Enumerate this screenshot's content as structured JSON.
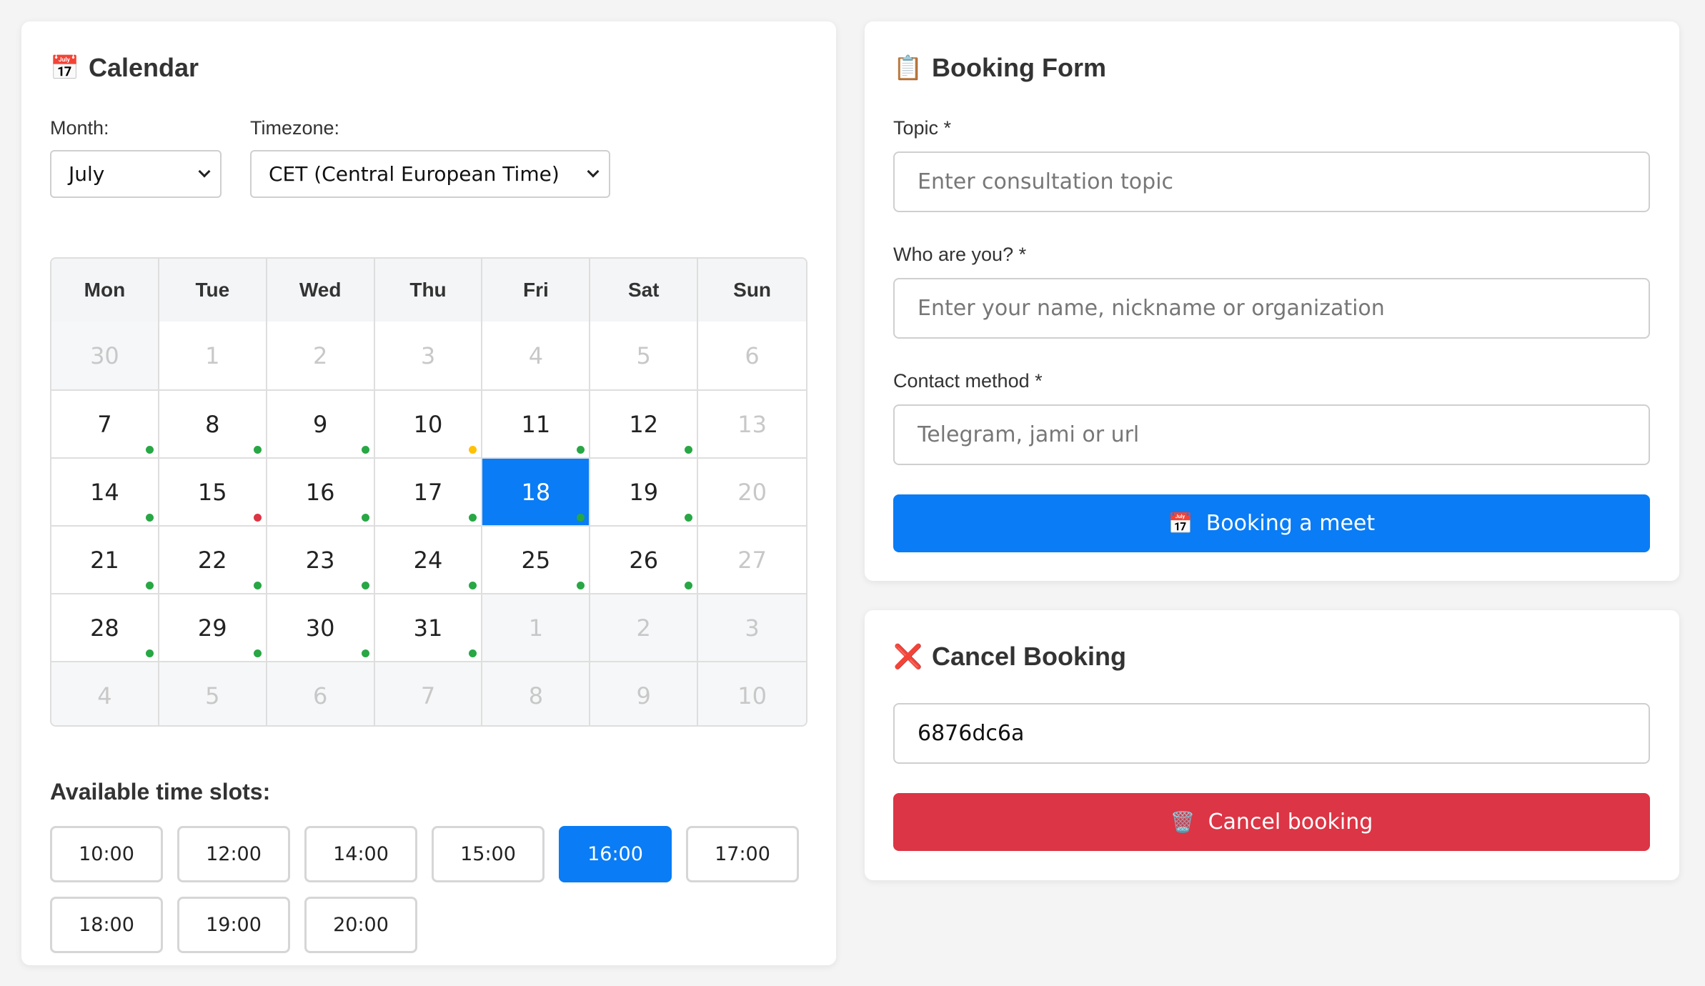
{
  "calendar": {
    "title": "Calendar",
    "icon": "calendar-icon",
    "month_label": "Month:",
    "month_value": "July",
    "timezone_label": "Timezone:",
    "timezone_value": "CET (Central European Time)",
    "weekdays": [
      "Mon",
      "Tue",
      "Wed",
      "Thu",
      "Fri",
      "Sat",
      "Sun"
    ],
    "status_colors": {
      "available": "#28a745",
      "partial": "#ffc107",
      "full": "#dc3545"
    },
    "weeks": [
      [
        {
          "day": "30",
          "state": "muted-other"
        },
        {
          "day": "1",
          "state": "muted"
        },
        {
          "day": "2",
          "state": "muted"
        },
        {
          "day": "3",
          "state": "muted"
        },
        {
          "day": "4",
          "state": "muted"
        },
        {
          "day": "5",
          "state": "muted"
        },
        {
          "day": "6",
          "state": "muted"
        }
      ],
      [
        {
          "day": "7",
          "dot": "available"
        },
        {
          "day": "8",
          "dot": "available"
        },
        {
          "day": "9",
          "dot": "available"
        },
        {
          "day": "10",
          "dot": "partial"
        },
        {
          "day": "11",
          "dot": "available"
        },
        {
          "day": "12",
          "dot": "available"
        },
        {
          "day": "13",
          "state": "muted"
        }
      ],
      [
        {
          "day": "14",
          "dot": "available"
        },
        {
          "day": "15",
          "dot": "full"
        },
        {
          "day": "16",
          "dot": "available"
        },
        {
          "day": "17",
          "dot": "available"
        },
        {
          "day": "18",
          "dot": "available",
          "state": "selected"
        },
        {
          "day": "19",
          "dot": "available"
        },
        {
          "day": "20",
          "state": "muted"
        }
      ],
      [
        {
          "day": "21",
          "dot": "available"
        },
        {
          "day": "22",
          "dot": "available"
        },
        {
          "day": "23",
          "dot": "available"
        },
        {
          "day": "24",
          "dot": "available"
        },
        {
          "day": "25",
          "dot": "available"
        },
        {
          "day": "26",
          "dot": "available"
        },
        {
          "day": "27",
          "state": "muted"
        }
      ],
      [
        {
          "day": "28",
          "dot": "available"
        },
        {
          "day": "29",
          "dot": "available"
        },
        {
          "day": "30",
          "dot": "available"
        },
        {
          "day": "31",
          "dot": "available"
        },
        {
          "day": "1",
          "state": "muted-other"
        },
        {
          "day": "2",
          "state": "muted-other"
        },
        {
          "day": "3",
          "state": "muted-other"
        }
      ],
      [
        {
          "day": "4",
          "state": "muted-other"
        },
        {
          "day": "5",
          "state": "muted-other"
        },
        {
          "day": "6",
          "state": "muted-other"
        },
        {
          "day": "7",
          "state": "muted-other"
        },
        {
          "day": "8",
          "state": "muted-other"
        },
        {
          "day": "9",
          "state": "muted-other"
        },
        {
          "day": "10",
          "state": "muted-other"
        }
      ]
    ],
    "slots_title": "Available time slots:",
    "slots": [
      "10:00",
      "12:00",
      "14:00",
      "15:00",
      "16:00",
      "17:00",
      "18:00",
      "19:00",
      "20:00"
    ],
    "selected_slot": "16:00"
  },
  "booking": {
    "title": "Booking Form",
    "icon": "clipboard-icon",
    "topic_label": "Topic *",
    "topic_placeholder": "Enter consultation topic",
    "topic_value": "",
    "who_label": "Who are you? *",
    "who_placeholder": "Enter your name, nickname or organization",
    "who_value": "",
    "contact_label": "Contact method *",
    "contact_placeholder": "Telegram, jami or url",
    "contact_value": "",
    "submit_label": "Booking a meet",
    "submit_color": "#0a7cf5"
  },
  "cancel": {
    "title": "Cancel Booking",
    "icon": "cross-mark-icon",
    "booking_id_value": "6876dc6a",
    "button_label": "Cancel booking",
    "button_color": "#dc3545"
  }
}
